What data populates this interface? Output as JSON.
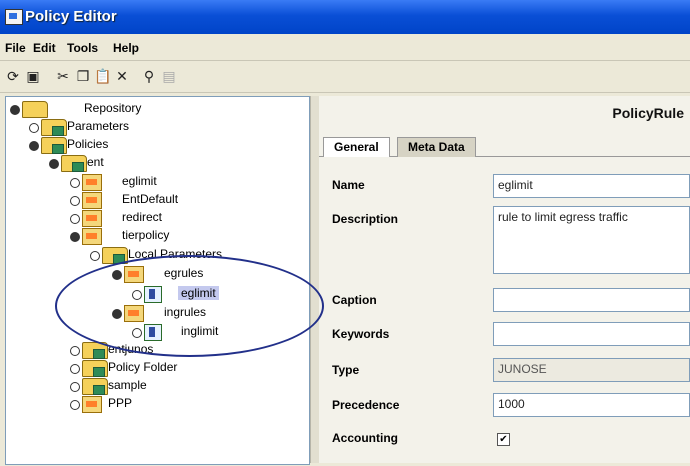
{
  "window": {
    "title": "Policy Editor"
  },
  "menu": [
    "File",
    "Edit",
    "Tools",
    "Help"
  ],
  "tree": {
    "nodes": [
      {
        "label": "Repository"
      },
      {
        "label": "Parameters"
      },
      {
        "label": "Policies"
      },
      {
        "label": "ent"
      },
      {
        "label": "eglimit"
      },
      {
        "label": "EntDefault"
      },
      {
        "label": "redirect"
      },
      {
        "label": "tierpolicy"
      },
      {
        "label": "Local Parameters"
      },
      {
        "label": "egrules"
      },
      {
        "label": "eglimit"
      },
      {
        "label": "ingrules"
      },
      {
        "label": "inglimit"
      },
      {
        "label": "entjunos"
      },
      {
        "label": "Policy Folder"
      },
      {
        "label": "sample"
      },
      {
        "label": "PPP"
      }
    ]
  },
  "panel": {
    "title": "PolicyRule",
    "tabs": [
      "General",
      "Meta Data"
    ],
    "fields": {
      "name_label": "Name",
      "name_value": "eglimit",
      "description_label": "Description",
      "description_value": "rule to limit egress traffic",
      "caption_label": "Caption",
      "caption_value": "",
      "keywords_label": "Keywords",
      "keywords_value": "",
      "type_label": "Type",
      "type_value": "JUNOSE",
      "precedence_label": "Precedence",
      "precedence_value": "1000",
      "accounting_label": "Accounting",
      "accounting_checked": "✔"
    }
  }
}
